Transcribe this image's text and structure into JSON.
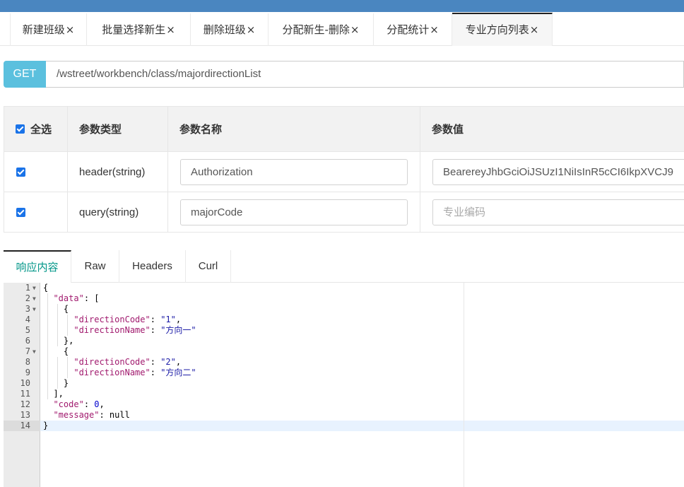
{
  "tabs": [
    {
      "label": "新建班级",
      "close": "×"
    },
    {
      "label": "批量选择新生",
      "close": "×"
    },
    {
      "label": "删除班级",
      "close": "×"
    },
    {
      "label": "分配新生-删除",
      "close": "×"
    },
    {
      "label": "分配统计",
      "close": "×"
    },
    {
      "label": "专业方向列表",
      "close": "×",
      "active": true
    }
  ],
  "request": {
    "method": "GET",
    "url": "/wstreet/workbench/class/majordirectionList"
  },
  "params": {
    "headers": {
      "select_all": "全选",
      "type": "参数类型",
      "name": "参数名称",
      "value": "参数值"
    },
    "rows": [
      {
        "checked": true,
        "type": "header(string)",
        "name": "Authorization",
        "value": "BearereyJhbGciOiJSUzI1NiIsInR5cCI6IkpXVCJ9",
        "value_placeholder": ""
      },
      {
        "checked": true,
        "type": "query(string)",
        "name": "majorCode",
        "value": "",
        "value_placeholder": "专业编码"
      }
    ]
  },
  "response_tabs": [
    {
      "label": "响应内容",
      "active": true
    },
    {
      "label": "Raw"
    },
    {
      "label": "Headers"
    },
    {
      "label": "Curl"
    }
  ],
  "editor": {
    "active_line": 14,
    "lines": [
      {
        "n": "1",
        "fold": true,
        "text": "{"
      },
      {
        "n": "2",
        "fold": true,
        "text": "  \"data\": ["
      },
      {
        "n": "3",
        "fold": true,
        "text": "    {"
      },
      {
        "n": "4",
        "text": "      \"directionCode\": \"1\","
      },
      {
        "n": "5",
        "text": "      \"directionName\": \"方向一\""
      },
      {
        "n": "6",
        "text": "    },"
      },
      {
        "n": "7",
        "fold": true,
        "text": "    {"
      },
      {
        "n": "8",
        "text": "      \"directionCode\": \"2\","
      },
      {
        "n": "9",
        "text": "      \"directionName\": \"方向二\""
      },
      {
        "n": "10",
        "text": "    }"
      },
      {
        "n": "11",
        "text": "  ],"
      },
      {
        "n": "12",
        "text": "  \"code\": 0,"
      },
      {
        "n": "13",
        "text": "  \"message\": null"
      },
      {
        "n": "14",
        "text": "}"
      }
    ]
  },
  "colors": {
    "topbar": "#4a86c0",
    "method_bg": "#5bc0de",
    "active_tab_text": "#009688",
    "checkbox": "#1a73e8"
  }
}
